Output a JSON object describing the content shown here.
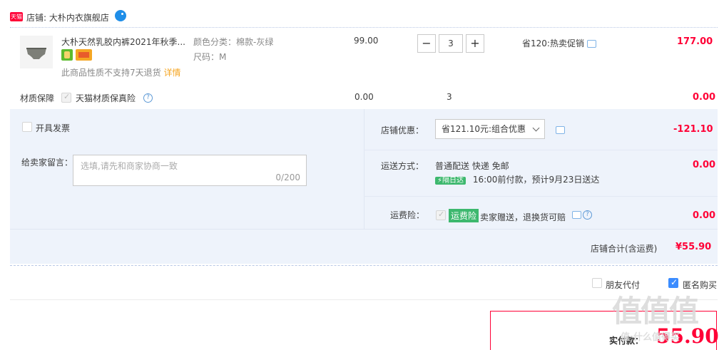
{
  "shop": {
    "prefix": "店铺:",
    "name": "大朴内衣旗舰店",
    "tmall_badge": "天猫"
  },
  "item": {
    "title": "大朴天然乳胶内裤2021年秋季...",
    "color_label": "颜色分类：棉款-灰绿",
    "size_label": "尺码：M",
    "price": "99.00",
    "quantity": "3",
    "promo": "省120:热卖促销",
    "subtotal": "177.00",
    "notice": "此商品性质不支持7天退货",
    "notice_link": "详情"
  },
  "insurance": {
    "label": "材质保障",
    "name": "天猫材质保真险",
    "price": "0.00",
    "quantity": "3",
    "subtotal": "0.00"
  },
  "invoice": {
    "label": "开具发票"
  },
  "message": {
    "label": "给卖家留言：",
    "placeholder": "选填,请先和商家协商一致",
    "counter": "0/200"
  },
  "discount": {
    "label": "店铺优惠：",
    "selected": "省121.10元:组合优惠",
    "amount": "-121.10"
  },
  "shipping": {
    "label": "运送方式：",
    "method": "普通配送 快递 免邮",
    "tag": "隔日达",
    "eta": "16:00前付款，预计9月23日送达",
    "amount": "0.00"
  },
  "freight_ins": {
    "label": "运费险：",
    "tag": "运费险",
    "desc": "卖家赠送，退换货可赔",
    "amount": "0.00"
  },
  "shop_total": {
    "label": "店铺合计(含运费)",
    "amount": "¥55.90"
  },
  "options": {
    "friend_pay": "朋友代付",
    "anonymous": "匿名购买"
  },
  "payment": {
    "label": "实付款：",
    "amount": "55.90"
  },
  "watermark": "值值值",
  "watermark_sub": "值·什么值得买"
}
